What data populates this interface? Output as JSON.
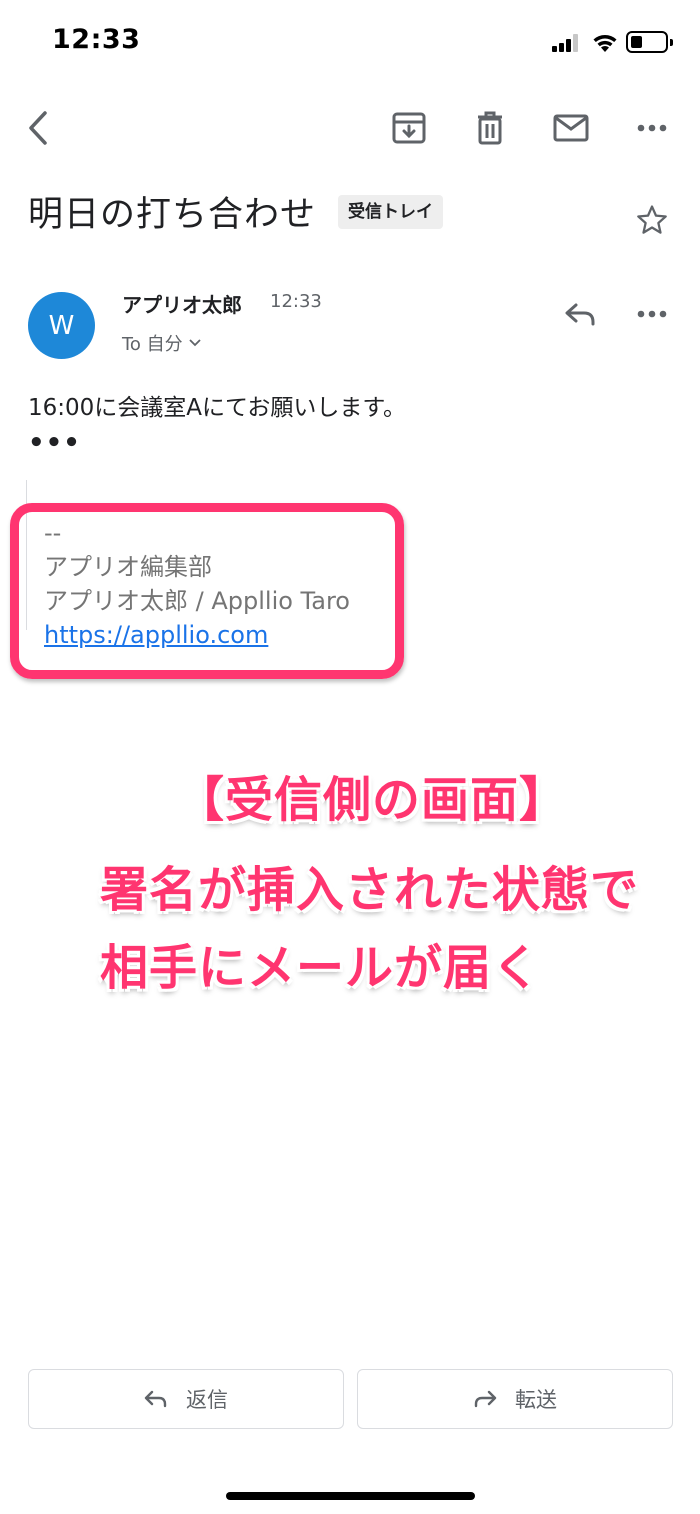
{
  "status_bar": {
    "time": "12:33"
  },
  "email": {
    "subject": "明日の打ち合わせ",
    "label": "受信トレイ",
    "sender": {
      "avatar_letter": "W",
      "name": "アプリオ太郎",
      "time": "12:33",
      "recipient": "To 自分"
    },
    "body": "16:00に会議室Aにてお願いします。",
    "quoted_toggle": "•••",
    "signature": {
      "separator": "--",
      "department": "アプリオ編集部",
      "name": "アプリオ太郎 / Appllio Taro",
      "url": "https://appllio.com"
    }
  },
  "annotation": {
    "line1": "【受信側の画面】",
    "line2": "署名が挿入された状態で",
    "line3": "相手にメールが届く"
  },
  "actions": {
    "reply": "返信",
    "forward": "転送"
  },
  "colors": {
    "accent": "#ff3570",
    "link": "#1a73e8",
    "avatar": "#1e88d8"
  },
  "icons": [
    "back-icon",
    "archive-icon",
    "trash-icon",
    "mail-icon",
    "more-vert-icon",
    "star-icon",
    "reply-icon",
    "forward-icon",
    "chevron-down-icon"
  ]
}
